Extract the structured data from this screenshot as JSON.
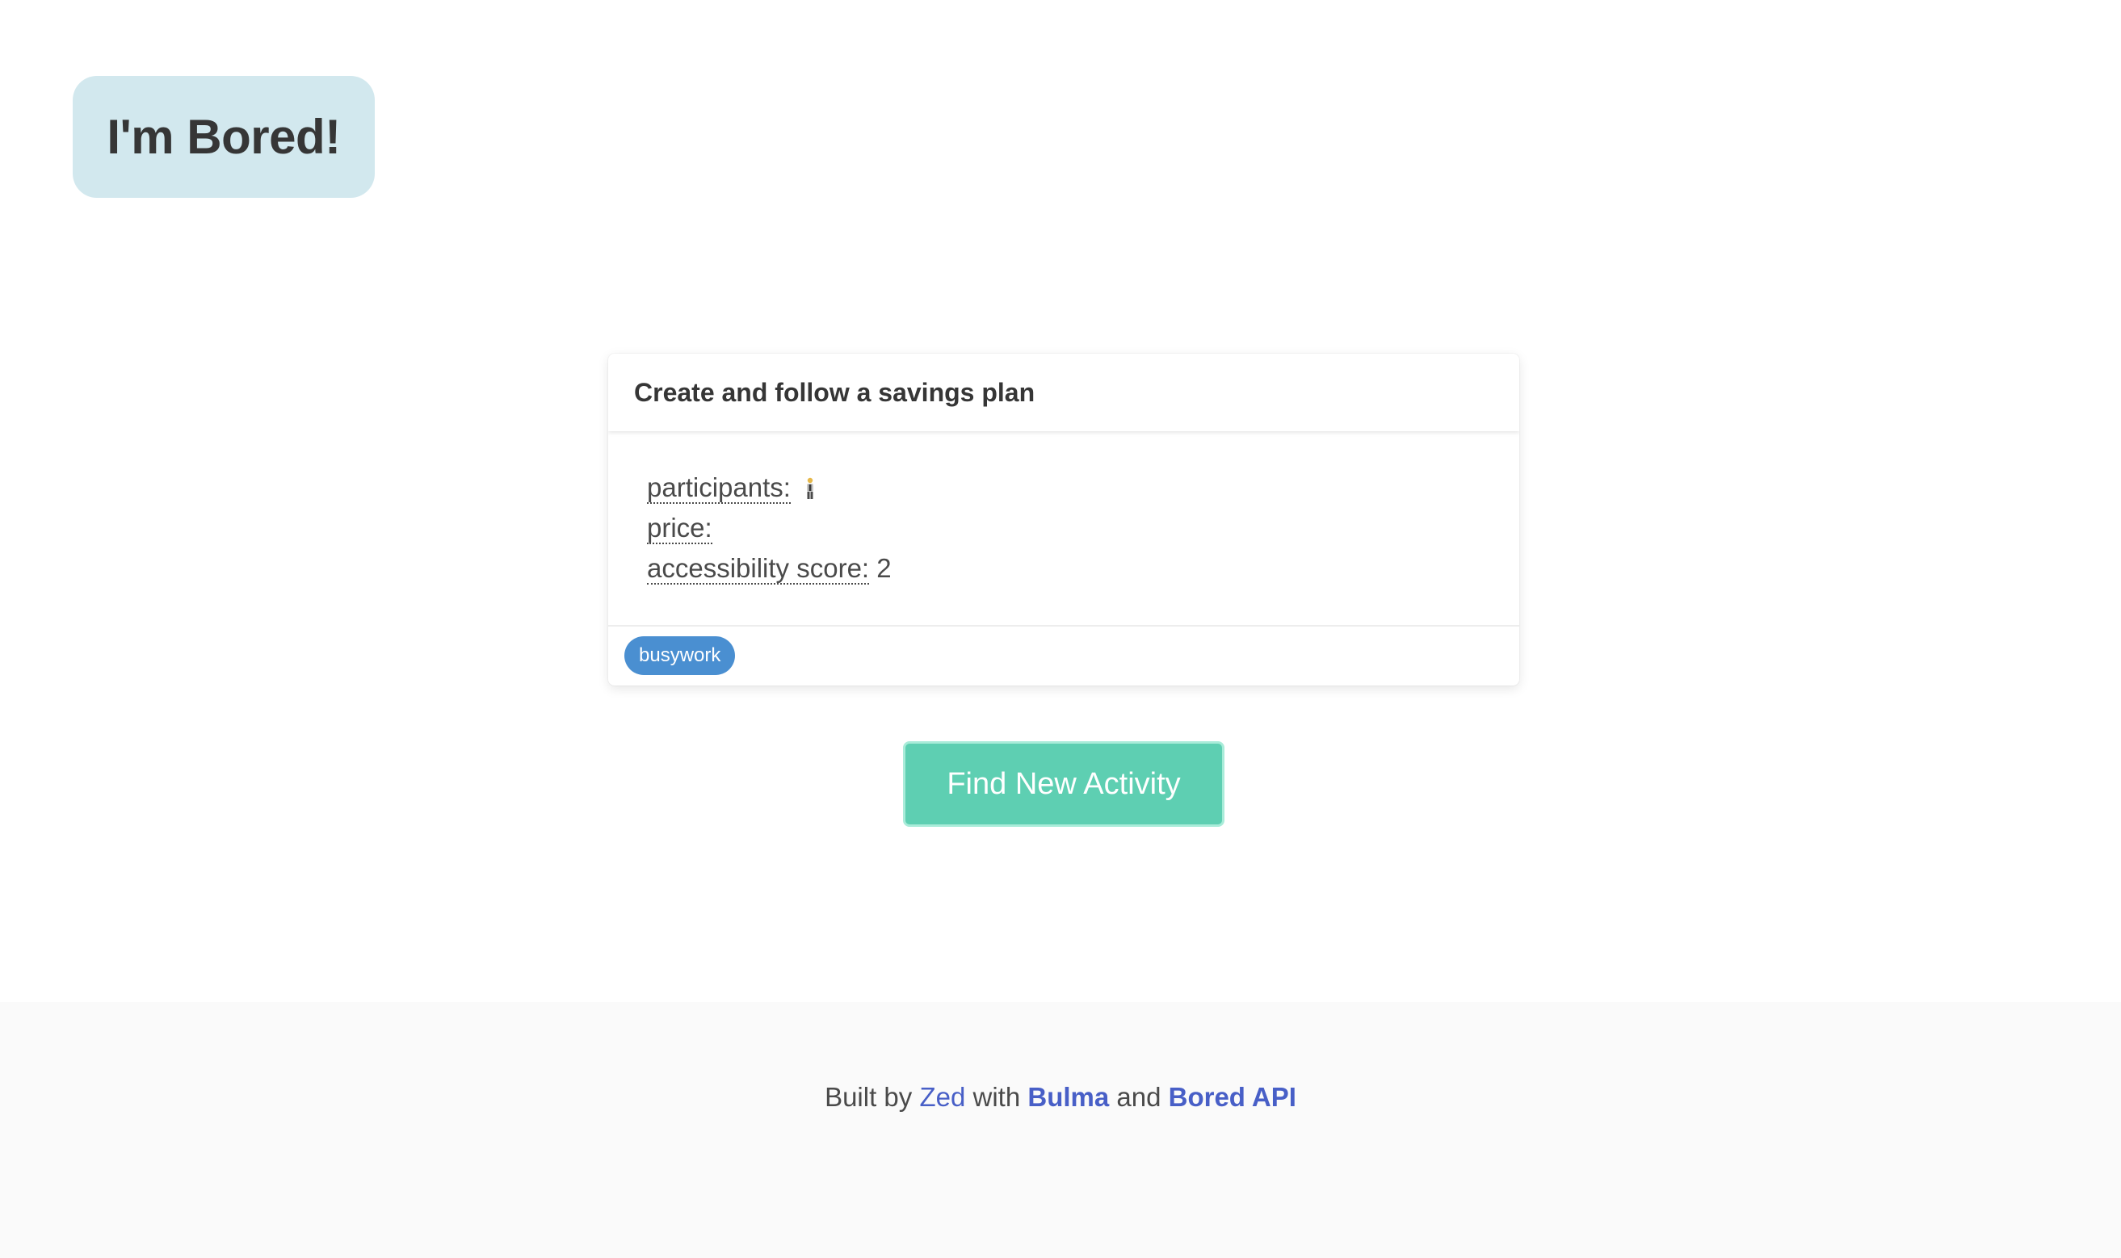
{
  "hero": {
    "title": "I'm Bored!"
  },
  "activity": {
    "title": "Create and follow a savings plan",
    "participants_label": "participants:",
    "participants_icon": "person-icon",
    "participants_count": 1,
    "price_label": "price:",
    "accessibility_label": "accessibility score:",
    "accessibility_value": "2",
    "type_tag": "busywork"
  },
  "actions": {
    "find_new_label": "Find New Activity"
  },
  "footer": {
    "built_by": "Built by",
    "author_link": "Zed",
    "with": "with",
    "bulma_link": "Bulma",
    "and": "and",
    "api_link": "Bored API"
  },
  "colors": {
    "hero_bg": "#d2e8ee",
    "button_bg": "#5ecfb2",
    "tag_bg": "#4a8fd1",
    "link": "#485fc7",
    "footer_bg": "#fafafa"
  }
}
